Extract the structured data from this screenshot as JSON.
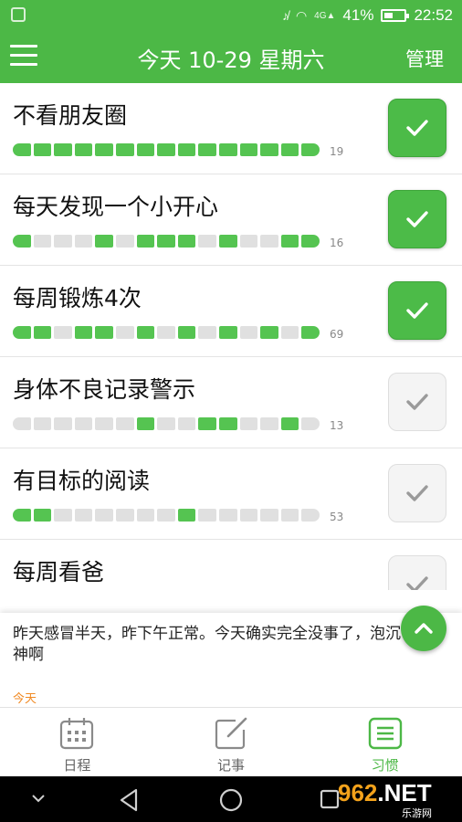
{
  "status_bar": {
    "signal_label": "4G",
    "battery_percent": "41%",
    "time": "22:52"
  },
  "header": {
    "title": "今天 10-29 星期六",
    "manage_label": "管理"
  },
  "habits": [
    {
      "name": "不看朋友圈",
      "count": "19",
      "checked": true,
      "segments": [
        1,
        1,
        1,
        1,
        1,
        1,
        1,
        1,
        1,
        1,
        1,
        1,
        1,
        1,
        1
      ]
    },
    {
      "name": "每天发现一个小开心",
      "count": "16",
      "checked": true,
      "segments": [
        1,
        0,
        0,
        0,
        1,
        0,
        1,
        1,
        1,
        0,
        1,
        0,
        0,
        1,
        1
      ]
    },
    {
      "name": "每周锻炼4次",
      "count": "69",
      "checked": true,
      "segments": [
        1,
        1,
        0,
        1,
        1,
        0,
        1,
        0,
        1,
        0,
        1,
        0,
        1,
        0,
        1
      ]
    },
    {
      "name": "身体不良记录警示",
      "count": "13",
      "checked": false,
      "segments": [
        0,
        0,
        0,
        0,
        0,
        0,
        1,
        0,
        0,
        1,
        1,
        0,
        0,
        1,
        0
      ]
    },
    {
      "name": "有目标的阅读",
      "count": "53",
      "checked": false,
      "segments": [
        1,
        1,
        0,
        0,
        0,
        0,
        0,
        0,
        1,
        0,
        0,
        0,
        0,
        0,
        0
      ]
    },
    {
      "name": "每周看爸",
      "count": "",
      "checked": false,
      "segments": []
    }
  ],
  "note": {
    "text": "昨天感冒半天，昨下午正常。今天确实完全没事了，泡沉香大神啊",
    "date_label": "今天"
  },
  "tabs": [
    {
      "label": "日程",
      "icon": "calendar-icon"
    },
    {
      "label": "记事",
      "icon": "edit-icon"
    },
    {
      "label": "习惯",
      "icon": "list-icon",
      "active": true
    }
  ],
  "watermark": {
    "brand": "962.NET",
    "brand_main": "962",
    "brand_suffix": ".NET",
    "subtitle": "乐游网"
  },
  "colors": {
    "accent": "#4cb846",
    "segment_on": "#55c451",
    "segment_off": "#e0e0e0",
    "date_orange": "#f08a24"
  }
}
